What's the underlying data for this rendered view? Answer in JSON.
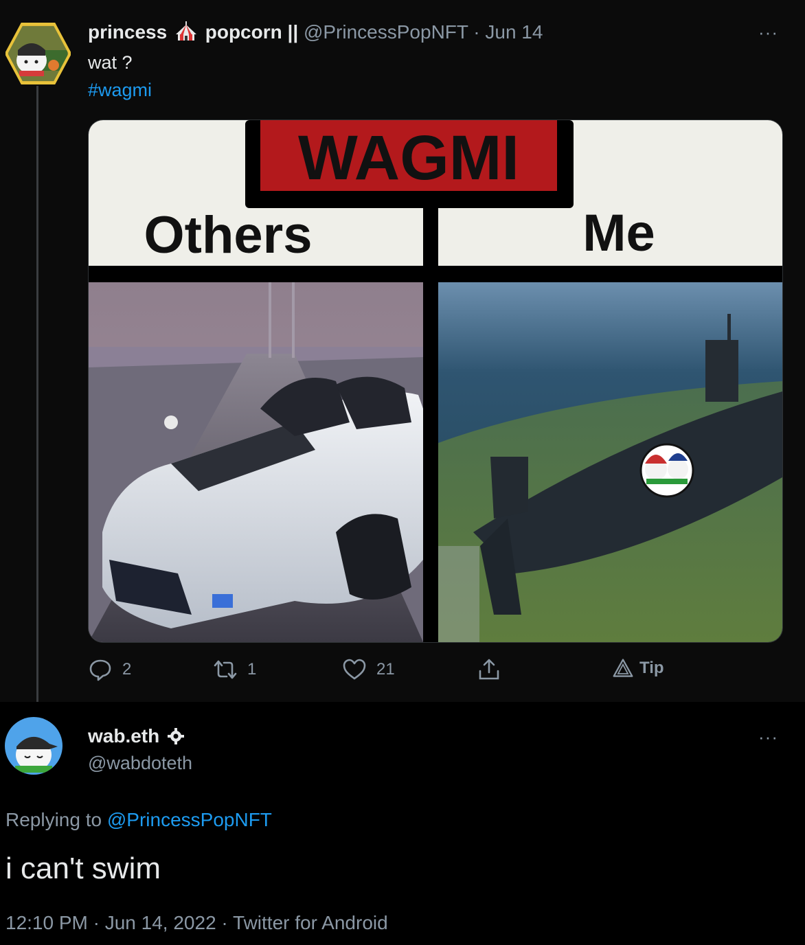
{
  "tweet1": {
    "author_name_part1": "princess",
    "author_name_part2": "popcorn ||",
    "handle": "@PrincessPopNFT",
    "sep": "·",
    "date": "Jun 14",
    "more": "···",
    "text": "wat ?",
    "hashtag": "#wagmi",
    "meme": {
      "sign": "WAGMI",
      "left_label": "Others",
      "right_label": "Me"
    },
    "actions": {
      "reply_count": "2",
      "retweet_count": "1",
      "like_count": "21",
      "tip_label": "Tip"
    }
  },
  "tweet2": {
    "author_name": "wab.eth",
    "handle": "@wabdoteth",
    "more": "···",
    "replying_prefix": "Replying to",
    "replying_handle": "@PrincessPopNFT",
    "text": "i can't swim",
    "timestamp": "12:10 PM · Jun 14, 2022 · Twitter for Android"
  },
  "colors": {
    "accent": "#1d9bf0",
    "muted": "#8b98a5",
    "text": "#e7e9ea",
    "sign_red": "#b3191c"
  }
}
